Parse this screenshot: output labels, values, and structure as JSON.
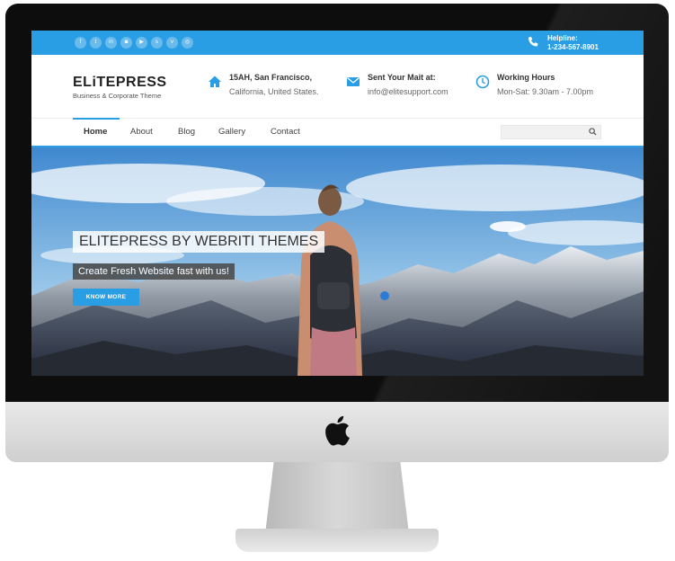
{
  "topbar": {
    "social_icons": [
      "facebook-icon",
      "twitter-icon",
      "linkedin-icon",
      "instagram-icon",
      "youtube-icon",
      "skype-icon",
      "vimeo-icon",
      "dribbble-icon"
    ],
    "social_glyphs": [
      "f",
      "t",
      "in",
      "◙",
      "▶",
      "s",
      "v",
      "◎"
    ],
    "helpline_label": "Helpline:",
    "helpline_number": "1-234-567-8901"
  },
  "header": {
    "logo": "ELiTEPRESS",
    "tagline": "Business & Corporate Theme",
    "address_title": "15AH, San Francisco,",
    "address_sub": "California, United States.",
    "mail_title": "Sent Your Mait at:",
    "mail_sub": "info@elitesupport.com",
    "hours_title": "Working Hours",
    "hours_sub": "Mon-Sat: 9.30am - 7.00pm"
  },
  "nav": {
    "items": [
      "Home",
      "About",
      "Blog",
      "Gallery",
      "Contact"
    ],
    "active": "Home"
  },
  "hero": {
    "title": "ELITEPRESS BY WEBRITI THEMES",
    "subtitle": "Create Fresh Website fast with us!",
    "button": "KNOW MORE"
  },
  "colors": {
    "accent": "#2a9ee4",
    "bezel": "#0d0d0d",
    "chin": "#dcdcdc"
  }
}
